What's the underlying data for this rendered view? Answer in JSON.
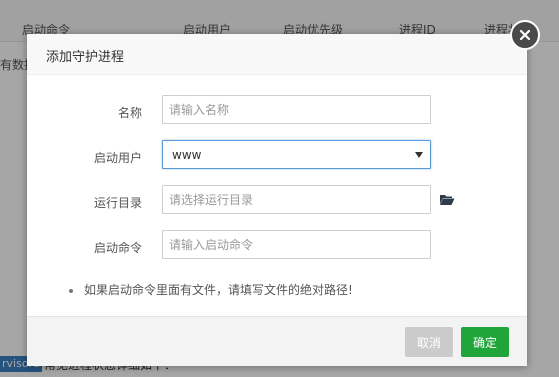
{
  "background": {
    "columns": [
      "启动命令",
      "启动用户",
      "启动优先级",
      "进程ID",
      "进程状"
    ],
    "empty_text": "有数据",
    "bottom_badge": "rvisord",
    "bottom_text": "常见进程状态详细如下："
  },
  "dialog": {
    "title": "添加守护进程",
    "fields": {
      "name": {
        "label": "名称",
        "placeholder": "请输入名称"
      },
      "user": {
        "label": "启动用户",
        "value": "www"
      },
      "dir": {
        "label": "运行目录",
        "placeholder": "请选择运行目录"
      },
      "cmd": {
        "label": "启动命令",
        "placeholder": "请输入启动命令"
      }
    },
    "tip": "如果启动命令里面有文件，请填写文件的绝对路径!",
    "buttons": {
      "cancel": "取消",
      "confirm": "确定"
    }
  },
  "colors": {
    "confirm": "#20a53a",
    "cancel": "#cbcbcb",
    "select_border": "#5b9bd5"
  },
  "icons": [
    "close-icon",
    "folder-open-icon",
    "caret-down-icon"
  ]
}
